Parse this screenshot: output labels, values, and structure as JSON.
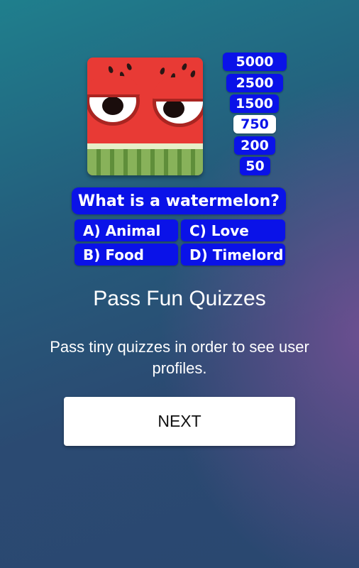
{
  "game": {
    "scores": [
      "5000",
      "2500",
      "1500",
      "750",
      "200",
      "50"
    ],
    "current_score": "750",
    "question": "What is a watermelon?",
    "answers": {
      "a": "A) Animal",
      "b": "B) Food",
      "c": "C) Love",
      "d": "D) Timelord"
    }
  },
  "onboarding": {
    "title": "Pass Fun Quizzes",
    "description": "Pass tiny quizzes in order to see user profiles.",
    "next_label": "NEXT"
  },
  "colors": {
    "quiz_blue": "#0a12e8",
    "watermelon_red": "#e83a35",
    "rind_green": "#88b25a"
  }
}
